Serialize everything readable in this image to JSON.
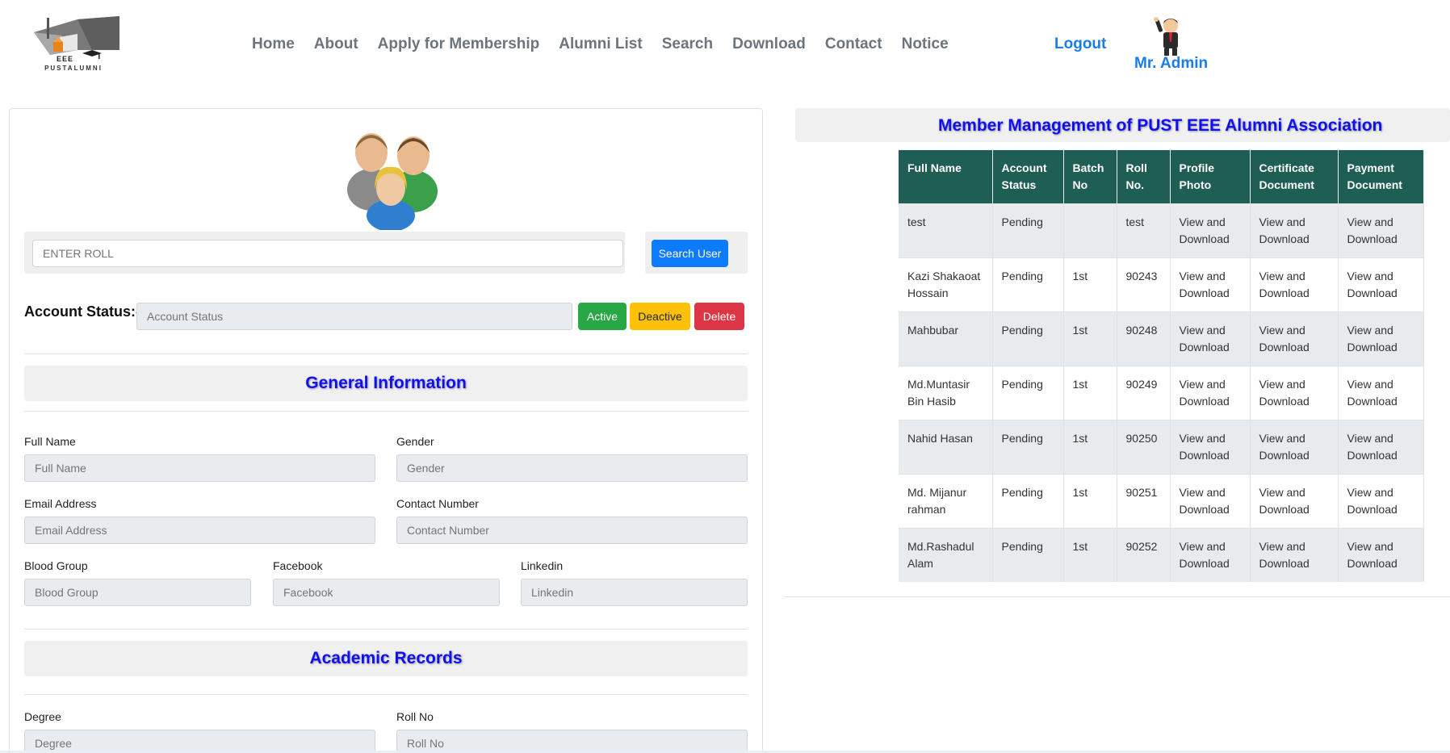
{
  "header": {
    "logo_text": "EEE",
    "logo_subtext": "PUSTALUMNI",
    "nav": [
      "Home",
      "About",
      "Apply for Membership",
      "Alumni List",
      "Search",
      "Download",
      "Contact",
      "Notice"
    ],
    "logout_label": "Logout",
    "admin_name": "Mr. Admin"
  },
  "search": {
    "placeholder": "ENTER ROLL",
    "button_label": "Search User"
  },
  "account_status": {
    "label": "Account Status:-",
    "placeholder": "Account Status",
    "active_label": "Active",
    "deactive_label": "Deactive",
    "delete_label": "Delete"
  },
  "general_info": {
    "title": "General Information",
    "full_name_label": "Full Name",
    "full_name_placeholder": "Full Name",
    "gender_label": "Gender",
    "gender_placeholder": "Gender",
    "email_label": "Email Address",
    "email_placeholder": "Email Address",
    "contact_label": "Contact Number",
    "contact_placeholder": "Contact Number",
    "blood_label": "Blood Group",
    "blood_placeholder": "Blood Group",
    "facebook_label": "Facebook",
    "facebook_placeholder": "Facebook",
    "linkedin_label": "Linkedin",
    "linkedin_placeholder": "Linkedin"
  },
  "academic": {
    "title": "Academic Records",
    "degree_label": "Degree",
    "degree_placeholder": "Degree",
    "roll_label": "Roll No",
    "roll_placeholder": "Roll No"
  },
  "members": {
    "title": "Member Management of PUST EEE Alumni Association",
    "columns": [
      "Full Name",
      "Account Status",
      "Batch No",
      "Roll No.",
      "Profile Photo",
      "Certificate Document",
      "Payment Document"
    ],
    "rows": [
      {
        "name": "test",
        "status": "Pending",
        "batch": "",
        "roll": "test",
        "photo": "View and Download",
        "cert": "View and Download",
        "pay": "View and Download"
      },
      {
        "name": "Kazi Shakaoat Hossain",
        "status": "Pending",
        "batch": "1st",
        "roll": "90243",
        "photo": "View and Download",
        "cert": "View and Download",
        "pay": "View and Download"
      },
      {
        "name": "Mahbubar",
        "status": "Pending",
        "batch": "1st",
        "roll": "90248",
        "photo": "View and Download",
        "cert": "View and Download",
        "pay": "View and Download"
      },
      {
        "name": "Md.Muntasir Bin Hasib",
        "status": "Pending",
        "batch": "1st",
        "roll": "90249",
        "photo": "View and Download",
        "cert": "View and Download",
        "pay": "View and Download"
      },
      {
        "name": "Nahid Hasan",
        "status": "Pending",
        "batch": "1st",
        "roll": "90250",
        "photo": "View and Download",
        "cert": "View and Download",
        "pay": "View and Download"
      },
      {
        "name": "Md. Mijanur rahman",
        "status": "Pending",
        "batch": "1st",
        "roll": "90251",
        "photo": "View and Download",
        "cert": "View and Download",
        "pay": "View and Download"
      },
      {
        "name": "Md.Rashadul Alam",
        "status": "Pending",
        "batch": "1st",
        "roll": "90252",
        "photo": "View and Download",
        "cert": "View and Download",
        "pay": "View and Download"
      }
    ]
  }
}
